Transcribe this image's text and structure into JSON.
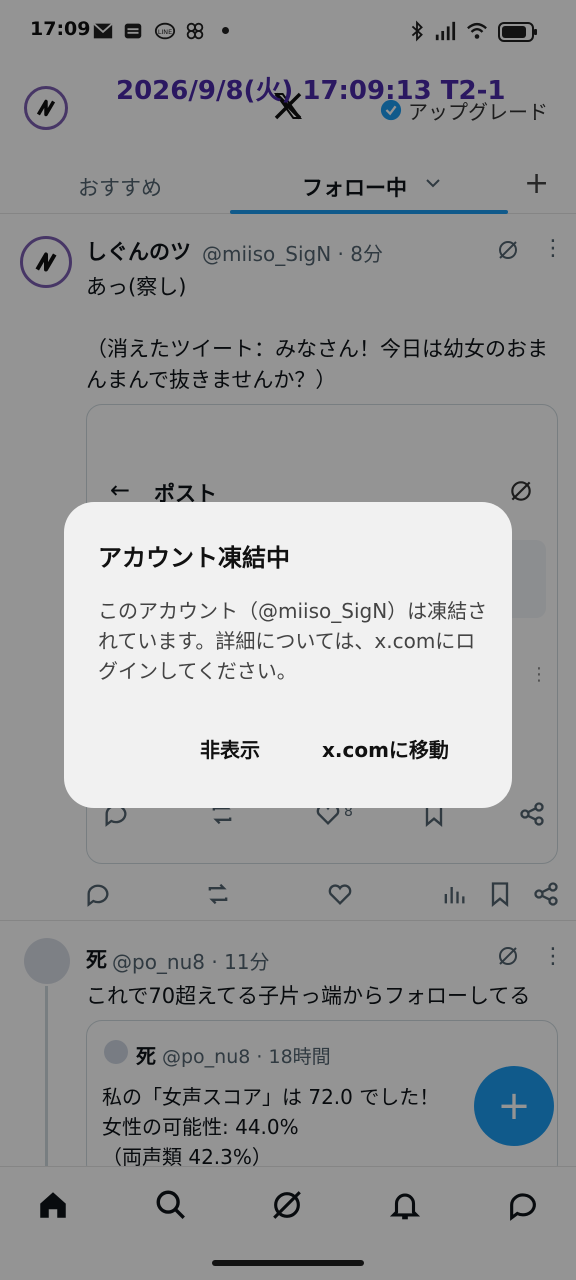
{
  "status": {
    "time": "17:09"
  },
  "overlay_timestamp": "2026/9/8(火) 17:09:13 T2-1",
  "header": {
    "upgrade_label": "アップグレード"
  },
  "tabs": [
    {
      "label": "おすすめ"
    },
    {
      "label": "フォロー中"
    }
  ],
  "post1": {
    "name": "しぐんのツ",
    "handle": "@miiso_SigN · 8分",
    "body_line1": "あっ(察し)",
    "body_line2": "（消えたツイート：みなさん！今日は幼女のおまんまんで抜きませんか？）",
    "quote_title": "ポスト",
    "quote_like_count": "8"
  },
  "post2": {
    "name": "死",
    "handle": "@po_nu8 · 11分",
    "body": "これで70超えてる子片っ端からフォローしてる",
    "quote": {
      "name": "死",
      "handle": "@po_nu8 · 18時間",
      "line1": "私の「女声スコア」は 72.0 でした！",
      "line2": "女性の可能性: 44.0%",
      "line3": "（両声類 42.3%）"
    }
  },
  "dialog": {
    "title": "アカウント凍結中",
    "body": "このアカウント（@miiso_SigN）は凍結されています。詳細については、x.comにログインしてください。",
    "hide_button": "非表示",
    "go_button": "x.comに移動"
  },
  "colors": {
    "accent": "#1d9bf0",
    "avatar_ring": "#7b5db0",
    "overlay_text": "#4b2aa8"
  }
}
